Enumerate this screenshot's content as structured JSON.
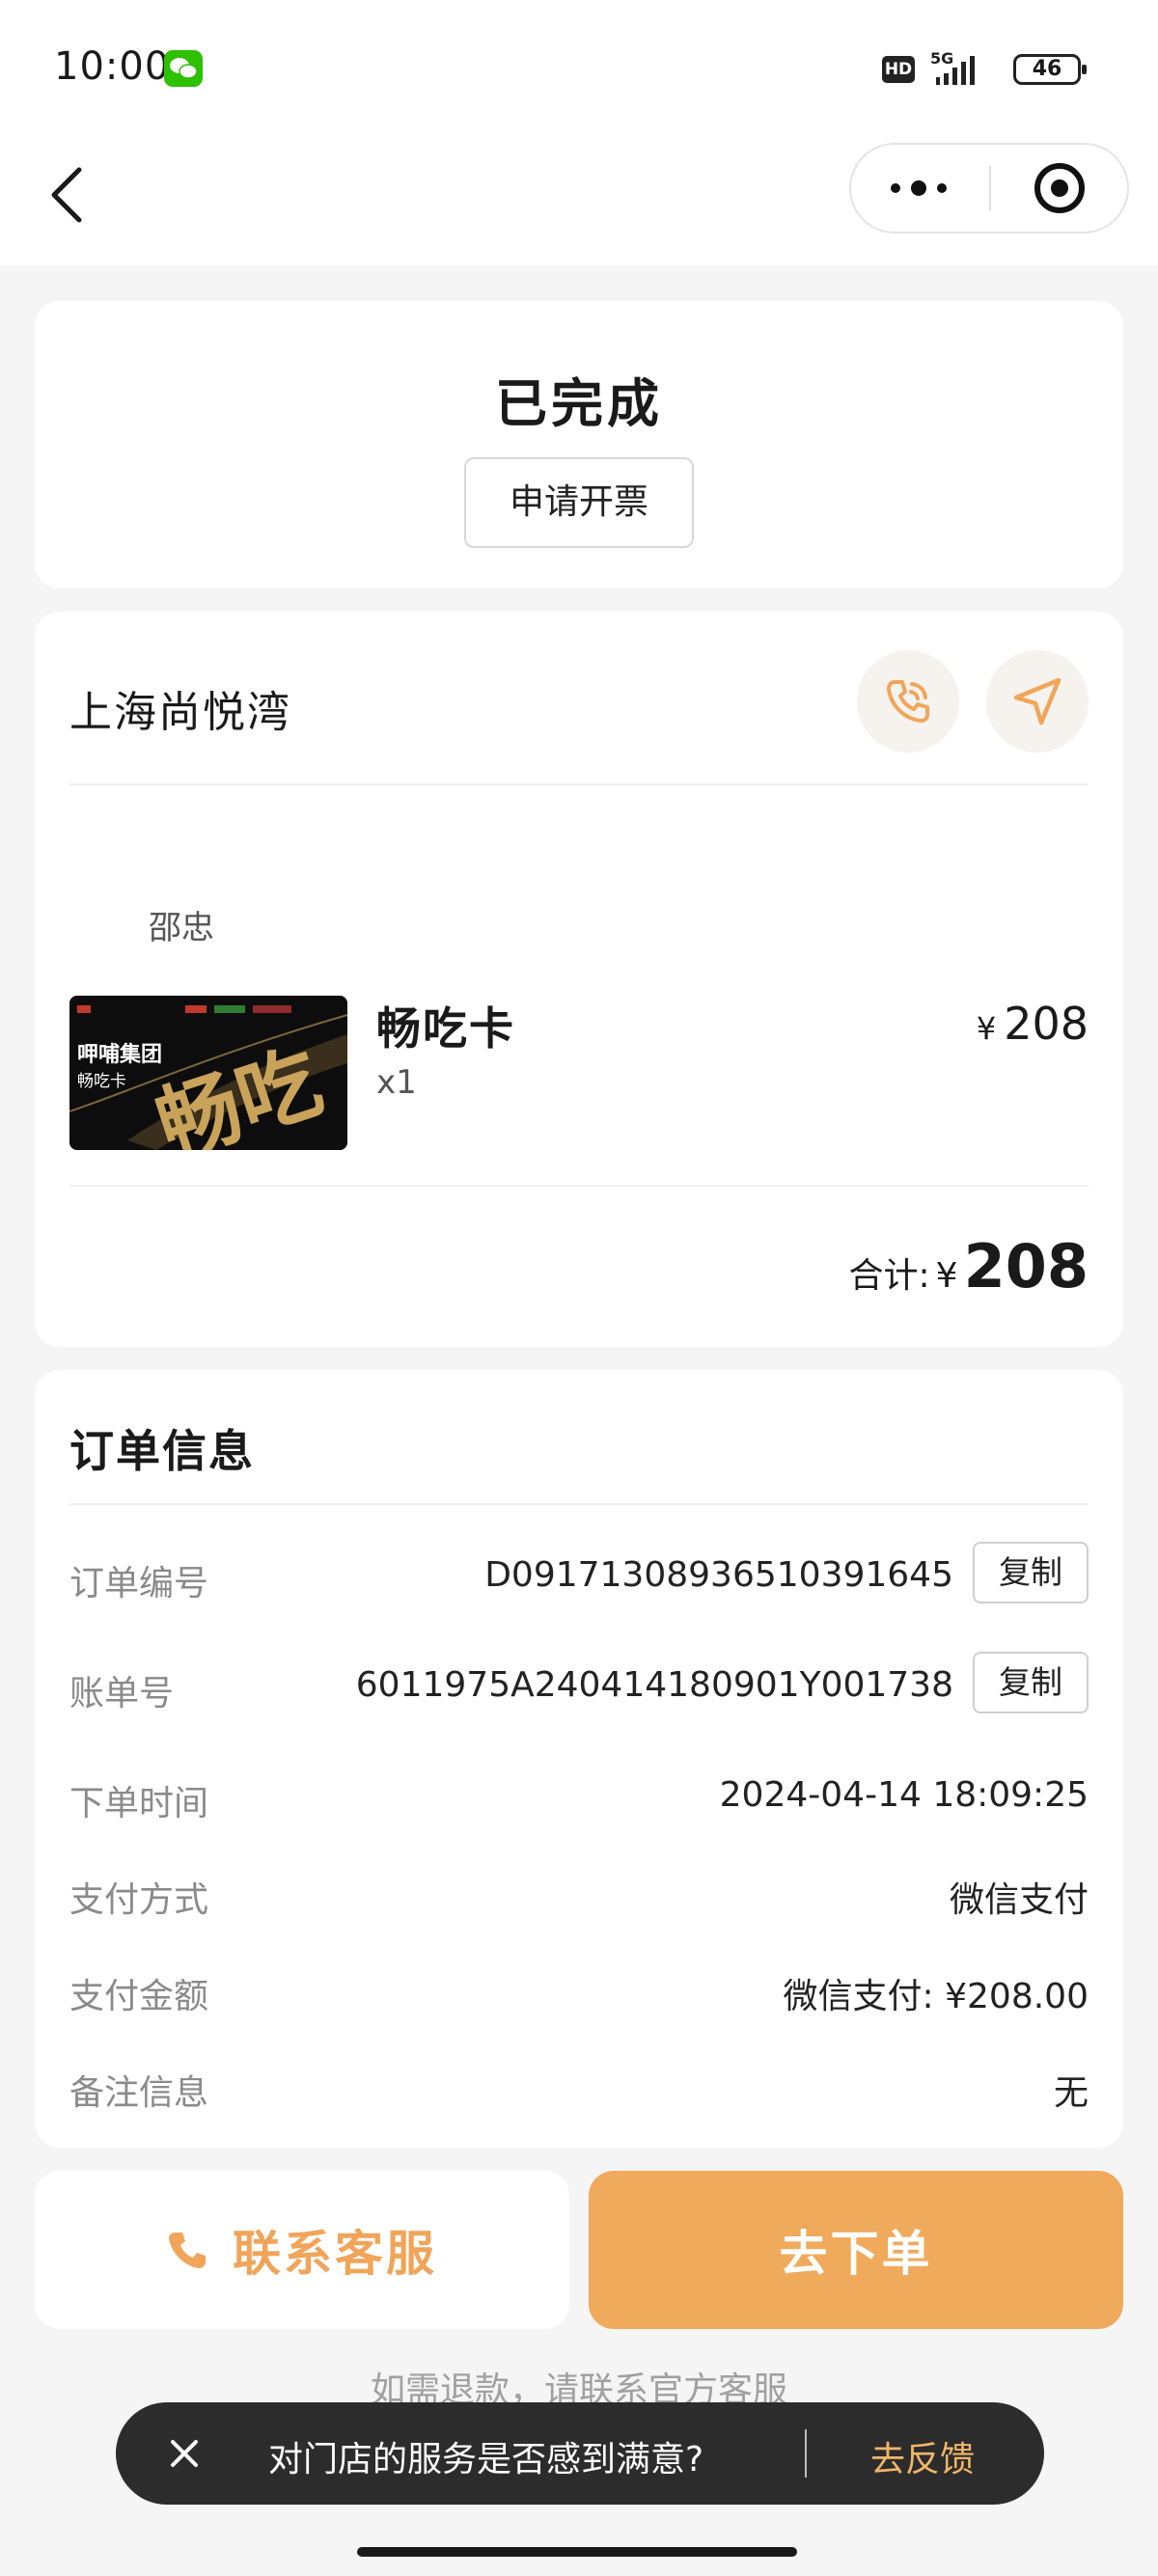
{
  "status_bar": {
    "time": "10:00",
    "hd": "HD",
    "network": "5G",
    "battery": "46"
  },
  "icons": {
    "back": "chevron-left-icon",
    "more": "more-dots-icon",
    "close": "target-circle-icon",
    "phone": "phone-icon",
    "navigate": "navigation-arrow-icon"
  },
  "order_status": {
    "title": "已完成",
    "invoice_label": "申请开票"
  },
  "store": {
    "name": "上海尚悦湾",
    "staff": "邵忠"
  },
  "product": {
    "image_text_brand": "呷哺集团",
    "image_text_card": "畅吃卡",
    "image_text_big": "畅吃",
    "name": "畅吃卡",
    "qty": "x1",
    "currency": "¥",
    "price": "208"
  },
  "total": {
    "label": "合计:",
    "currency": "¥",
    "value": "208"
  },
  "order_info": {
    "title": "订单信息",
    "copy_label": "复制",
    "rows": [
      {
        "label": "订单编号",
        "value": "D09171308936510391645"
      },
      {
        "label": "账单号",
        "value": "6011975A240414180901Y001738"
      },
      {
        "label": "下单时间",
        "value": "2024-04-14 18:09:25"
      },
      {
        "label": "支付方式",
        "value": "微信支付"
      },
      {
        "label": "支付金额",
        "value": "微信支付: ¥208.00"
      },
      {
        "label": "备注信息",
        "value": "无"
      }
    ]
  },
  "actions": {
    "contact_label": "联系客服",
    "order_label": "去下单"
  },
  "refund": {
    "prefix": "如需退款，请",
    "link": "联系官方客服"
  },
  "toast": {
    "text": "对门店的服务是否感到满意?",
    "link": "去反馈"
  },
  "colors": {
    "accent": "#f0aa5c",
    "accent_text": "#f0a55a",
    "background": "#f5f5f5"
  }
}
